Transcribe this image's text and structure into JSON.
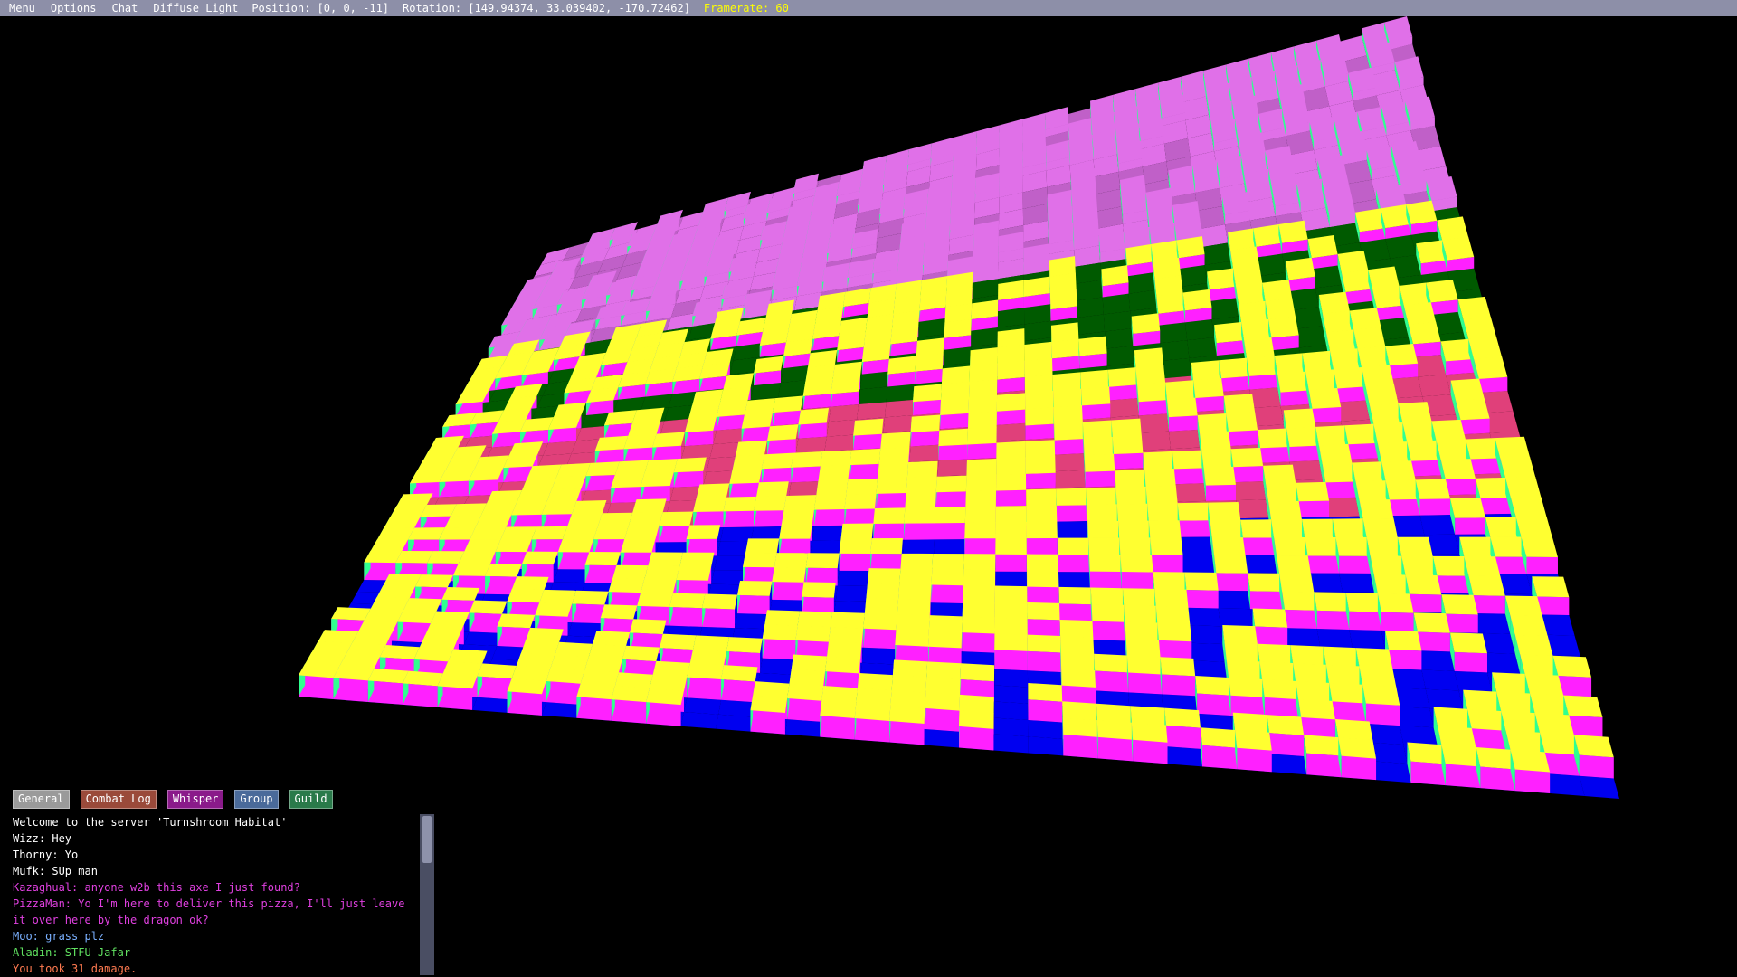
{
  "menubar": {
    "menu": "Menu",
    "options": "Options",
    "chat": "Chat",
    "diffuse_light": "Diffuse Light",
    "position": "Position: [0, 0, -11]",
    "rotation": "Rotation: [149.94374, 33.039402, -170.72462]",
    "framerate": "Framerate: 60"
  },
  "scene": {
    "description_icon": "voxel-terrain",
    "colors": {
      "far_band": "#e070e8",
      "far_band_shadow": "#c060c8",
      "green_band": "#005a00",
      "pink_band": "#e0407a",
      "blue_band": "#0000f0",
      "block_top": "#ffff30",
      "block_side": "#ff20ff",
      "block_edge": "#30ff90"
    }
  },
  "chat": {
    "tabs": [
      {
        "label": "General",
        "color": "#9a9a9a"
      },
      {
        "label": "Combat Log",
        "color": "#9a4a3a"
      },
      {
        "label": "Whisper",
        "color": "#8a1a8a"
      },
      {
        "label": "Group",
        "color": "#4a6a9a"
      },
      {
        "label": "Guild",
        "color": "#2a7a4a"
      }
    ],
    "lines": [
      {
        "text": "Welcome to the server 'Turnshroom Habitat'",
        "color": "#ffffff"
      },
      {
        "text": "Wizz: Hey",
        "color": "#ffffff"
      },
      {
        "text": "Thorny: Yo",
        "color": "#ffffff"
      },
      {
        "text": "Mufk: SUp man",
        "color": "#ffffff"
      },
      {
        "text": "Kazaghual: anyone w2b this axe I just found?",
        "color": "#e040e0"
      },
      {
        "text": "PizzaMan: Yo I'm here to deliver this pizza, I'll just leave it over here by the dragon ok?",
        "color": "#e040e0"
      },
      {
        "text": "Moo: grass plz",
        "color": "#7ab0ff"
      },
      {
        "text": "Aladin: STFU Jafar",
        "color": "#60e060"
      },
      {
        "text": "You took 31 damage.",
        "color": "#ff7a50"
      }
    ]
  }
}
